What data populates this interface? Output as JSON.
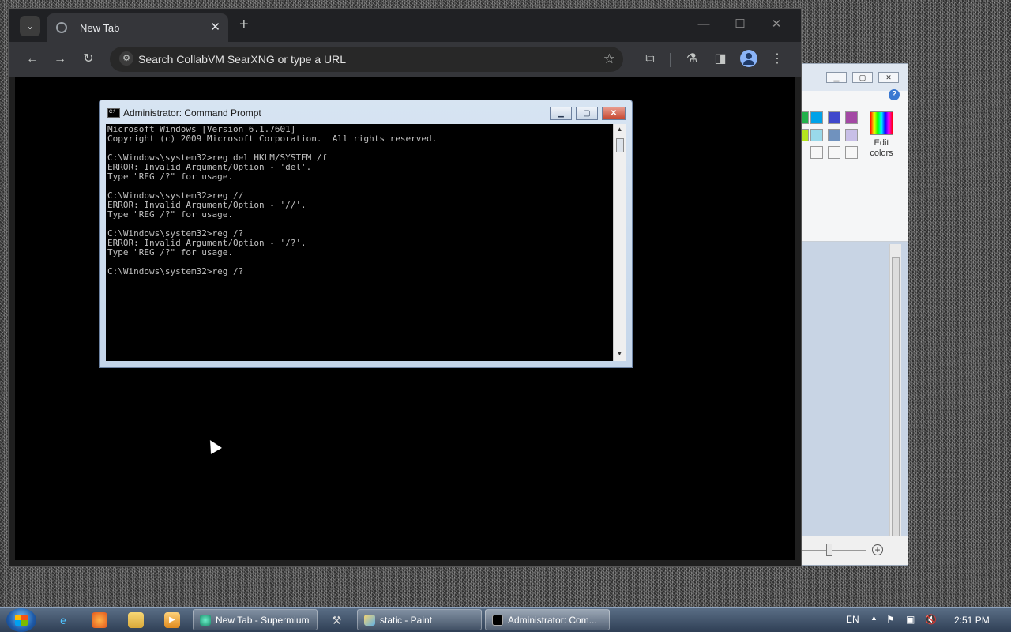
{
  "browser": {
    "tab": {
      "title": "New Tab"
    },
    "omnibox": {
      "placeholder": "Search CollabVM SearXNG or type a URL"
    }
  },
  "cmd": {
    "title": "Administrator: Command Prompt",
    "console_text": "Microsoft Windows [Version 6.1.7601]\nCopyright (c) 2009 Microsoft Corporation.  All rights reserved.\n\nC:\\Windows\\system32>reg del HKLM/SYSTEM /f\nERROR: Invalid Argument/Option - 'del'.\nType \"REG /?\" for usage.\n\nC:\\Windows\\system32>reg //\nERROR: Invalid Argument/Option - '//'.\nType \"REG /?\" for usage.\n\nC:\\Windows\\system32>reg /?\nERROR: Invalid Argument/Option - '/?'.\nType \"REG /?\" for usage.\n\nC:\\Windows\\system32>reg /?"
  },
  "paint": {
    "edit_colors_line1": "Edit",
    "edit_colors_line2": "colors",
    "palette_row1": [
      "#22b14c",
      "#00a2e8",
      "#3f48cc",
      "#a349a4"
    ],
    "palette_row2": [
      "#b5e61d",
      "#99d9ea",
      "#7092be",
      "#c8bfe7"
    ]
  },
  "taskbar": {
    "tasks": [
      {
        "label": "New Tab - Supermium"
      },
      {
        "label": "static - Paint"
      },
      {
        "label": "Administrator: Com..."
      }
    ],
    "language": "EN",
    "time": "2:51 PM"
  },
  "colors": {
    "accent": "#8ab4f8",
    "console_bg": "#000000",
    "console_fg": "#c0c0c0"
  }
}
